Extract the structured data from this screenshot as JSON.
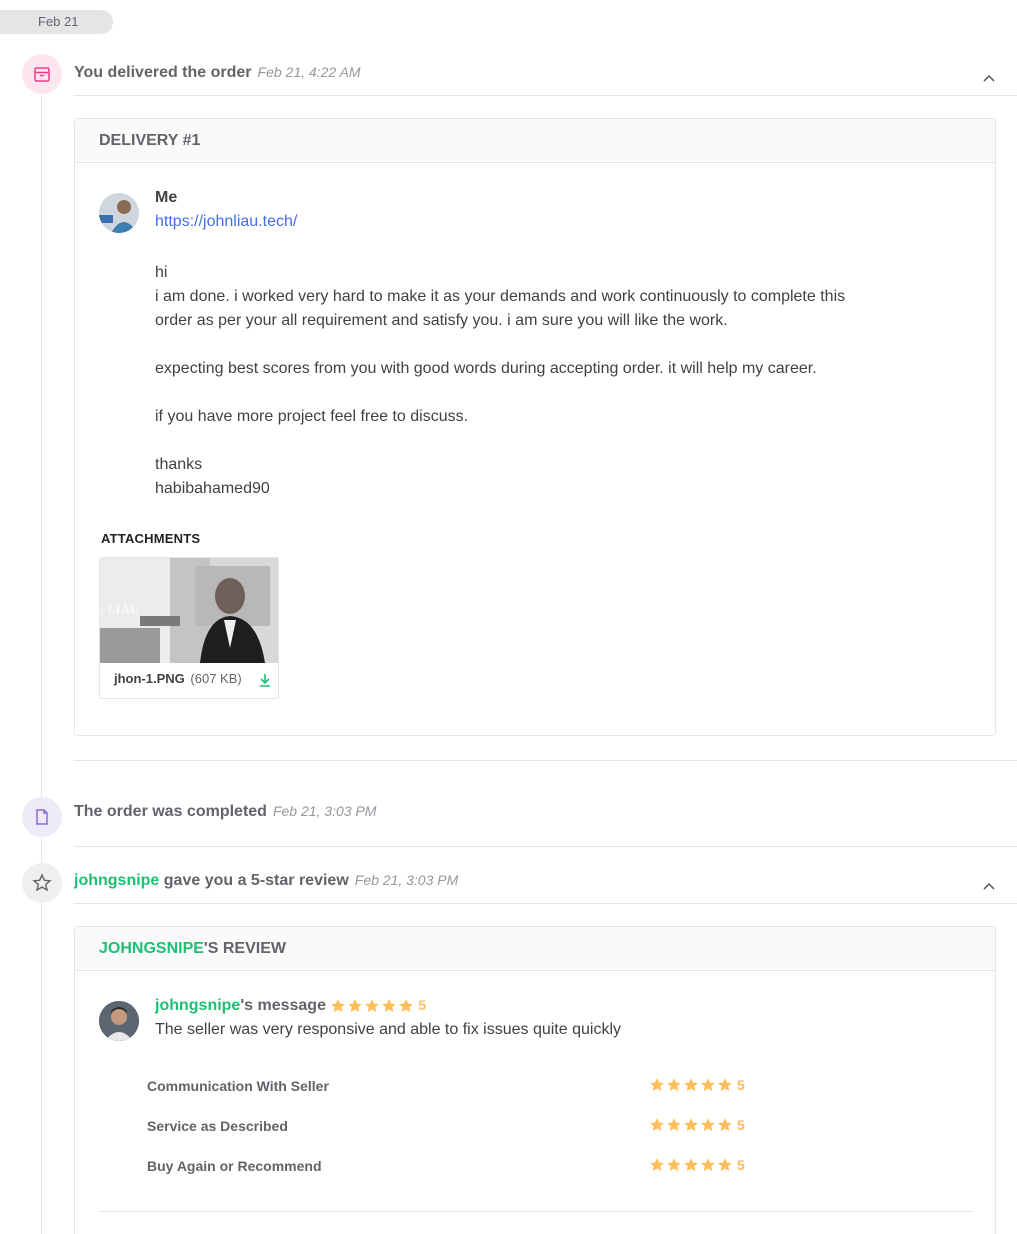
{
  "date_divider": "Feb 21",
  "delivered_event": {
    "title": "You delivered the order",
    "time": "Feb 21, 4:22 AM",
    "icon": "package-icon"
  },
  "delivery": {
    "header": "DELIVERY #1",
    "sender": "Me",
    "link": "https://johnliau.tech/",
    "message_lines": [
      "hi",
      "i am done. i worked very hard to make it as your demands and work continuously to complete this",
      "order as per your all requirement and satisfy you. i am sure you will like the work.",
      "",
      "expecting best scores from you with good words during accepting order. it will help my career.",
      "",
      "if you have more project feel free to discuss.",
      "",
      "thanks",
      "habibahamed90"
    ],
    "attachments_label": "ATTACHMENTS",
    "attachment": {
      "filename": "jhon-1.PNG",
      "size": "(607 KB)",
      "thumb_text": "S LIAU"
    }
  },
  "completed_event": {
    "title": "The order was completed",
    "time": "Feb 21, 3:03 PM",
    "icon": "document-icon"
  },
  "review_event": {
    "user": "johngsnipe",
    "title_rest": " gave you a 5-star review",
    "time": "Feb 21, 3:03 PM",
    "icon": "star-outline-icon"
  },
  "review": {
    "header_user": "JOHNGSNIPE",
    "header_rest": "'S REVIEW",
    "user": "johngsnipe",
    "user_suffix": "'s message",
    "overall_score": "5",
    "text": "The seller was very responsive and able to fix issues quite quickly",
    "criteria": [
      {
        "label": "Communication With Seller",
        "score": "5"
      },
      {
        "label": "Service as Described",
        "score": "5"
      },
      {
        "label": "Buy Again or Recommend",
        "score": "5"
      }
    ]
  },
  "colors": {
    "accent_green": "#1dbf73",
    "star_yellow": "#ffbe5b",
    "link_blue": "#446ee7",
    "delivered_icon_bg": "#fde6f0",
    "completed_icon_bg": "#eeebf8",
    "review_icon_bg": "#efeff0"
  }
}
